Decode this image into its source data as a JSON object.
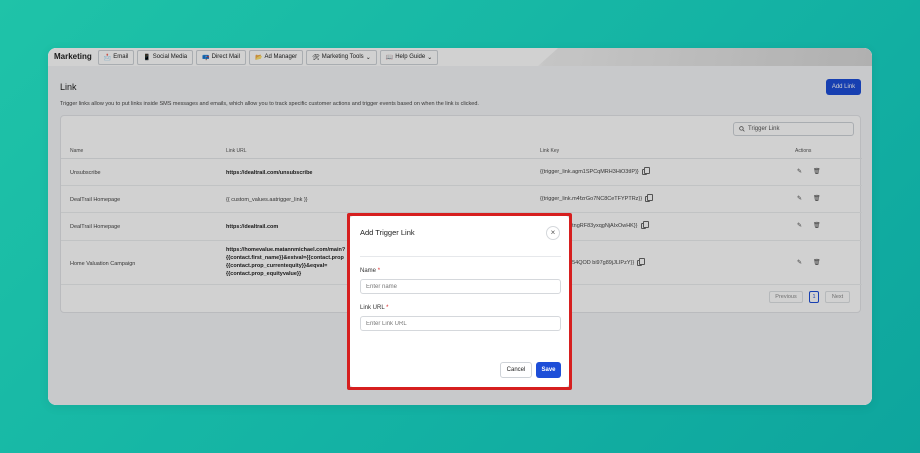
{
  "nav": {
    "brand": "Marketing",
    "items": [
      {
        "icon": "📩",
        "label": "Email"
      },
      {
        "icon": "📱",
        "label": "Social Media"
      },
      {
        "icon": "📪",
        "label": "Direct Mail"
      },
      {
        "icon": "📂",
        "label": "Ad Manager"
      },
      {
        "icon": "🛠",
        "label": "Marketing Tools"
      },
      {
        "icon": "📖",
        "label": "Help Guide"
      }
    ],
    "chevron": "⌄"
  },
  "page": {
    "title": "Link",
    "description": "Trigger links allow you to put links inside SMS messages and emails, which allow you to track specific customer actions and trigger events based on when the link is clicked.",
    "add_button": "Add Link"
  },
  "search": {
    "placeholder": "Trigger Link"
  },
  "table": {
    "headers": [
      "Name",
      "Link URL",
      "Link Key",
      "Actions"
    ],
    "rows": [
      {
        "name": "Unsubscribe",
        "url": "https://dealtrail.com/unsubscribe",
        "key": "{{trigger_link.agm1SPCqMRH3HiO3tIP}}"
      },
      {
        "name": "DealTrail Homepage",
        "url": "{{ custom_values.aatrigger_link }}",
        "key": "{{trigger_link.m4fzrGo7NC8CeTFYPTRz}}"
      },
      {
        "name": "DealTrail Homepage",
        "url": "https://dealtrail.com",
        "key": "{{trigger_link.tngRF83yxqgNjAIxOwHK}}"
      },
      {
        "name": "Home Valuation Campaign",
        "url_lines": [
          "https://homevalue.matannmichael.com/main?",
          "{{contact.first_name}}&estval={{contact.prop",
          "{{contact.prop_currentequity}}&eqval=",
          "{{contact.prop_equityvalue}}"
        ],
        "key": "{{trigger_link.54QOD bi97g89jJLIPzY}}"
      }
    ]
  },
  "pagination": {
    "previous": "Previous",
    "page": "1",
    "next": "Next"
  },
  "modal": {
    "title": "Add Trigger Link",
    "close": "×",
    "name_label": "Name",
    "name_placeholder": "Enter name",
    "url_label": "Link URL",
    "url_placeholder": "Enter Link URL",
    "required_mark": "*",
    "cancel": "Cancel",
    "save": "Save"
  },
  "colors": {
    "accent": "#1d4ed8",
    "highlight": "#d61f1f"
  },
  "icons": {
    "search": "search-icon",
    "edit": "pencil-icon",
    "delete": "trash-icon",
    "copy": "copy-icon",
    "close": "close-icon"
  }
}
